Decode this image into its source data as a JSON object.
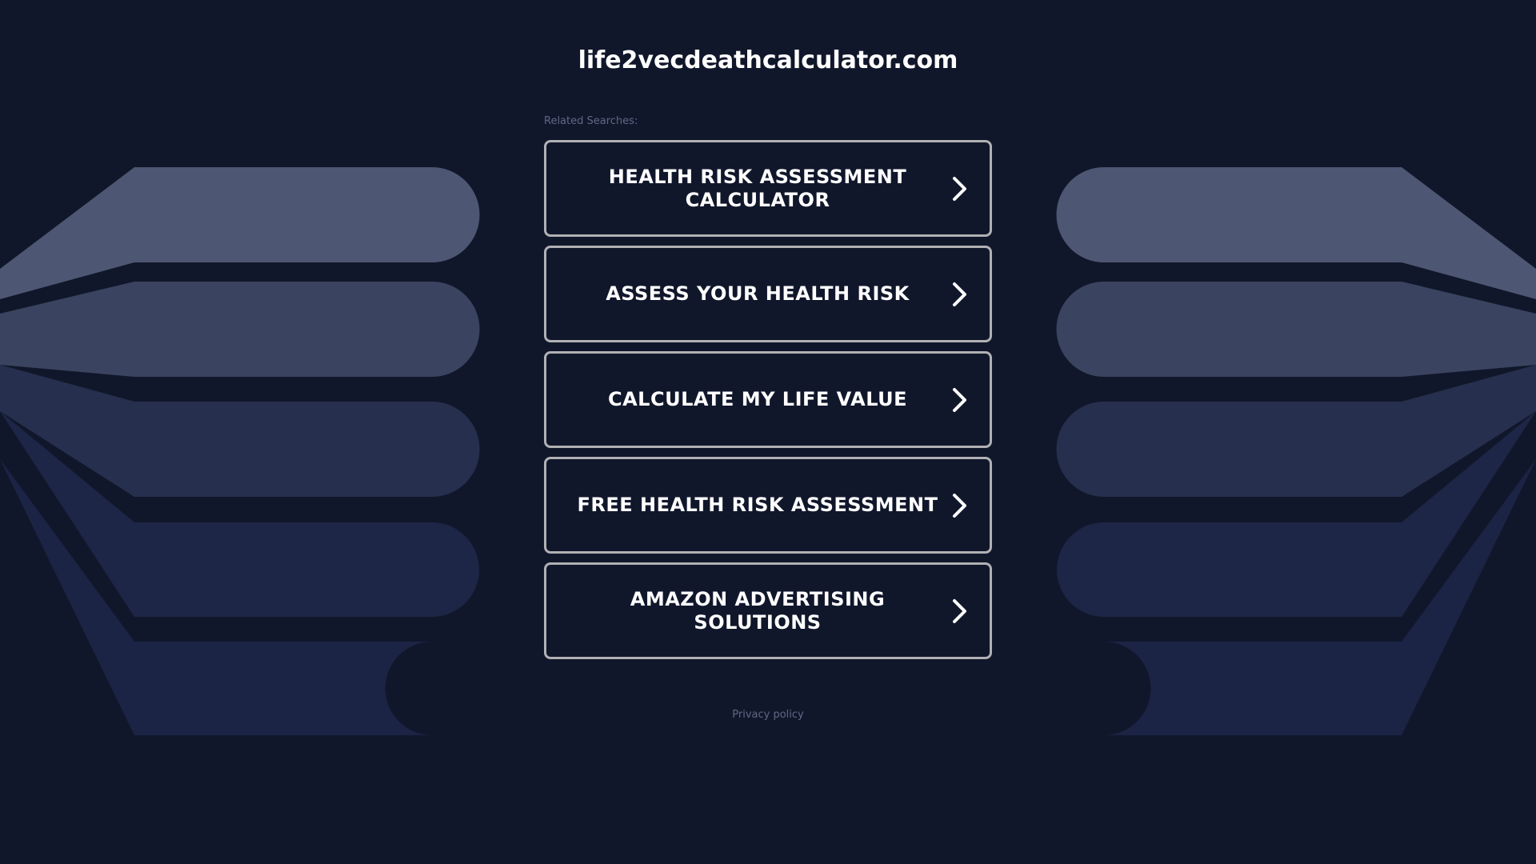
{
  "header": {
    "domain": "life2vecdeathcalculator.com"
  },
  "related": {
    "label": "Related Searches:",
    "links": [
      {
        "label": "HEALTH RISK ASSESSMENT CALCULATOR"
      },
      {
        "label": "ASSESS YOUR HEALTH RISK"
      },
      {
        "label": "CALCULATE MY LIFE VALUE"
      },
      {
        "label": "FREE HEALTH RISK ASSESSMENT"
      },
      {
        "label": "AMAZON ADVERTISING SOLUTIONS"
      }
    ],
    "link_icon": "chevron-right-icon"
  },
  "footer": {
    "privacy_label": "Privacy policy"
  },
  "colors": {
    "background": "#11172b",
    "box_border": "#b1b1b4",
    "text": "#ffffff",
    "muted_text": "#5f6886",
    "shape_1": "#4d5672",
    "shape_2": "#3a435f",
    "shape_3": "#262f4d",
    "shape_4": "#1d2646",
    "shape_5": "#1b2444"
  }
}
